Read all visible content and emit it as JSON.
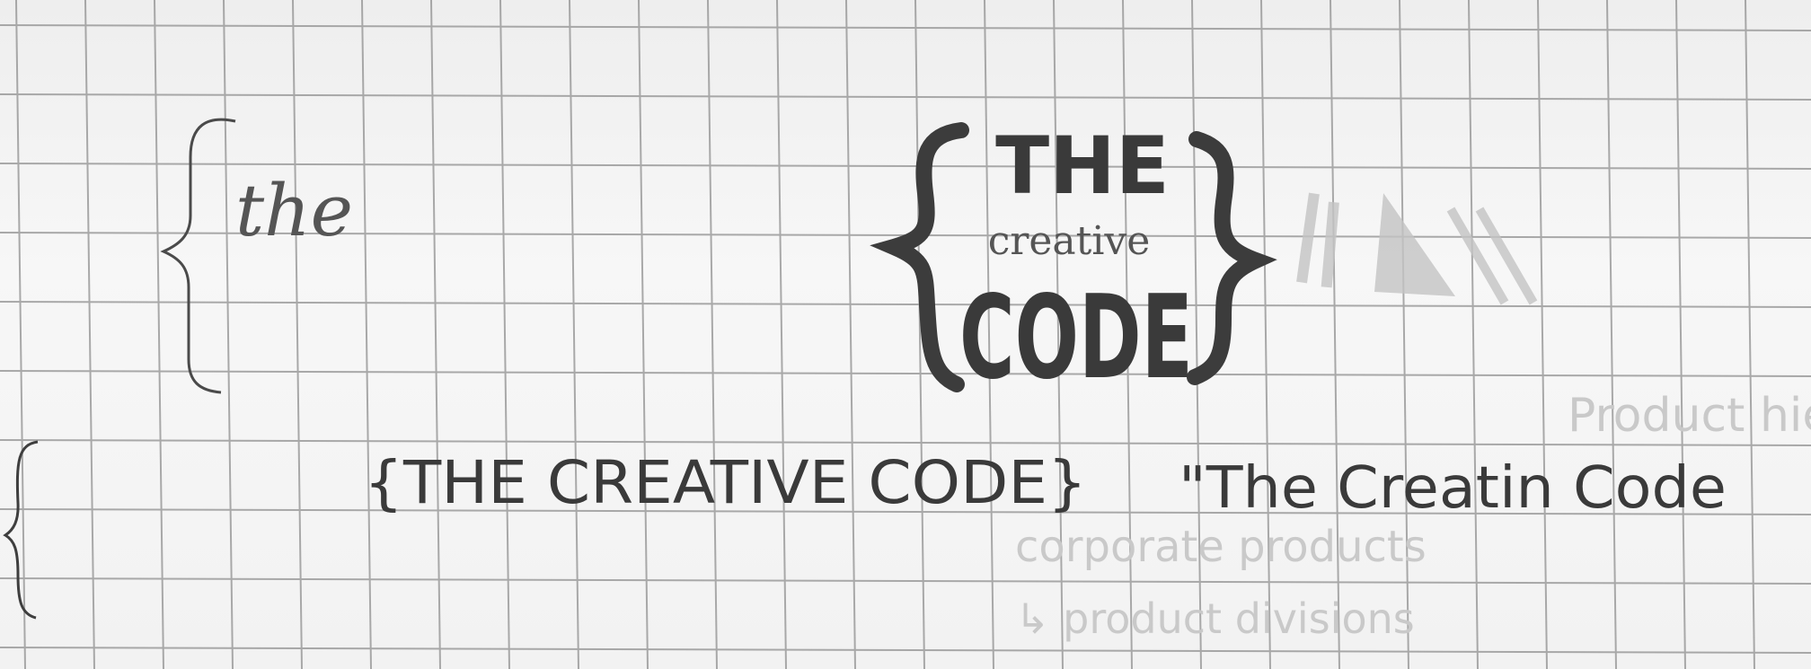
{
  "sketch_1": {
    "brace": "{",
    "text": "the"
  },
  "logo": {
    "line_1": "THE",
    "line_2": "creative",
    "line_3": "CODE",
    "brace_left": "{",
    "brace_right": "}"
  },
  "sketch_2": {
    "brace": "{"
  },
  "sketch_3": {
    "text": "{THE CREATIVE CODE}"
  },
  "sketch_4": {
    "text": "\"The Creatin Code"
  },
  "bleed_through": {
    "lines": [
      "Product hierarchy",
      "corporate products",
      "↳ product divisions"
    ]
  },
  "colors": {
    "paper": "#f2f2f2",
    "grid": "#8a8a8a",
    "pencil": "#3a3a3a"
  }
}
